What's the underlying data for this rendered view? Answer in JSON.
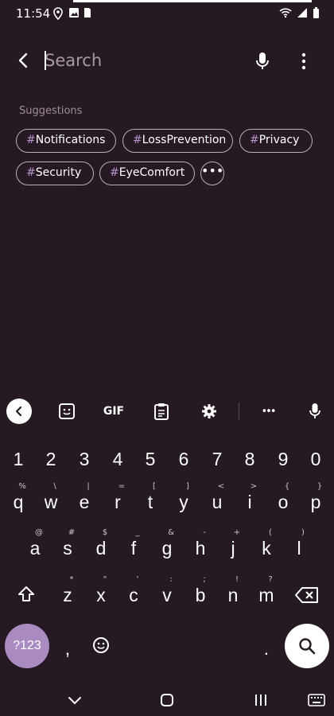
{
  "status_bar": {
    "time": "11:54"
  },
  "search": {
    "placeholder": "Search",
    "value": ""
  },
  "suggestions": {
    "title": "Suggestions",
    "chips": [
      "Notifications",
      "LossPrevention",
      "Privacy",
      "Security",
      "EyeComfort"
    ],
    "hash": "#",
    "more_glyph": "•••"
  },
  "keyboard": {
    "toolbar": {
      "gif_label": "GIF",
      "more_glyph": "•••"
    },
    "digits": [
      "1",
      "2",
      "3",
      "4",
      "5",
      "6",
      "7",
      "8",
      "9",
      "0"
    ],
    "row1": [
      {
        "k": "q",
        "s": "%"
      },
      {
        "k": "w",
        "s": "\\"
      },
      {
        "k": "e",
        "s": "|"
      },
      {
        "k": "r",
        "s": "="
      },
      {
        "k": "t",
        "s": "["
      },
      {
        "k": "y",
        "s": "]"
      },
      {
        "k": "u",
        "s": "<"
      },
      {
        "k": "i",
        "s": ">"
      },
      {
        "k": "o",
        "s": "{"
      },
      {
        "k": "p",
        "s": "}"
      }
    ],
    "row2": [
      {
        "k": "a",
        "s": "@"
      },
      {
        "k": "s",
        "s": "#"
      },
      {
        "k": "d",
        "s": "$"
      },
      {
        "k": "f",
        "s": "_"
      },
      {
        "k": "g",
        "s": "&"
      },
      {
        "k": "h",
        "s": "-"
      },
      {
        "k": "j",
        "s": "+"
      },
      {
        "k": "k",
        "s": "("
      },
      {
        "k": "l",
        "s": ")"
      }
    ],
    "row3": [
      {
        "k": "z",
        "s": "*"
      },
      {
        "k": "x",
        "s": "\""
      },
      {
        "k": "c",
        "s": "'"
      },
      {
        "k": "v",
        "s": ":"
      },
      {
        "k": "b",
        "s": ";"
      },
      {
        "k": "n",
        "s": "!"
      },
      {
        "k": "m",
        "s": "?"
      }
    ],
    "sym_label": "?123",
    "comma": ",",
    "period": "."
  },
  "colors": {
    "background": "#251923",
    "accent": "#a98bc2",
    "chip_border": "#b9b0b7"
  }
}
